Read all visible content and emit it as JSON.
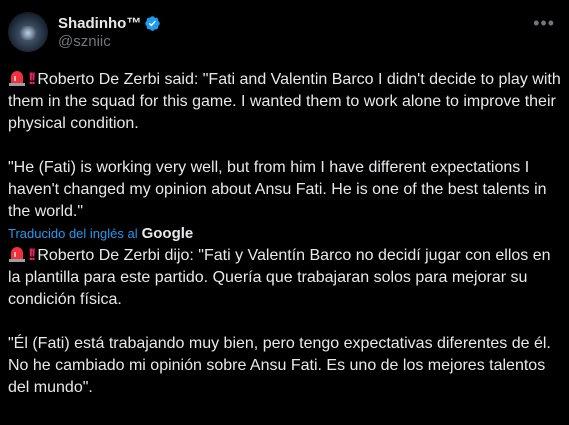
{
  "author": {
    "display_name": "Shadinho™",
    "handle": "@szniic"
  },
  "icons": {
    "verified": "verified-badge-icon",
    "more": "more-options-icon",
    "siren": "police-siren-icon",
    "double_exclamation": "double-exclamation-icon"
  },
  "colors": {
    "accent": "#1d9bf0",
    "text": "#e7e9ea",
    "muted": "#71767b"
  },
  "original": {
    "paragraph1": "Roberto De Zerbi said: \"Fati and Valentin Barco I didn't decide to play with them in the squad for this game. I wanted them to work alone to improve their physical condition.",
    "paragraph2": "\"He (Fati) is working very well, but from him I have different expectations I haven't changed my opinion about Ansu Fati. He is one of the best talents in the world.\""
  },
  "translation": {
    "label": "Traducido del inglés al",
    "provider": "Google",
    "paragraph1": "Roberto De Zerbi dijo: \"Fati y Valentín Barco no decidí jugar con ellos en la plantilla para este partido. Quería que trabajaran solos para mejorar su condición física.",
    "paragraph2": "\"Él (Fati) está trabajando muy bien, pero tengo expectativas diferentes de él. No he cambiado mi opinión sobre Ansu Fati. Es uno de los mejores talentos del mundo\"."
  }
}
